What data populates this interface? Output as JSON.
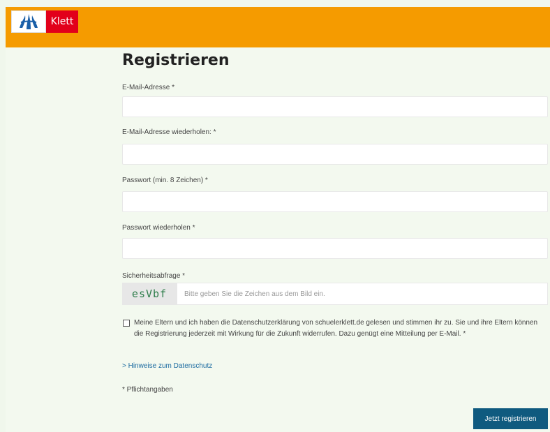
{
  "header": {
    "brand": "Klett",
    "bg_color": "#f59b00",
    "brand_color": "#e2001a"
  },
  "form": {
    "title": "Registrieren",
    "email_label": "E-Mail-Adresse *",
    "email_value": "",
    "email_repeat_label": "E-Mail-Adresse wiederholen: *",
    "email_repeat_value": "",
    "password_label": "Passwort (min. 8 Zeichen) *",
    "password_value": "",
    "password_repeat_label": "Passwort wiederholen *",
    "password_repeat_value": "",
    "captcha_label": "Sicherheitsabfrage *",
    "captcha_image_text": "esVbf",
    "captcha_placeholder": "Bitte geben Sie die Zeichen aus dem Bild ein.",
    "consent_checked": false,
    "consent_text": "Meine Eltern und ich haben die Datenschutzerklärung von schuelerklett.de gelesen und stimmen ihr zu. Sie und ihre Eltern können die Registrierung jederzeit mit Wirkung für die Zukunft widerrufen. Dazu genügt eine Mitteilung per E-Mail. *",
    "privacy_link": "> Hinweise zum Datenschutz",
    "required_note": "* Pflichtangaben",
    "submit_label": "Jetzt registrieren",
    "submit_color": "#0f5a7f"
  }
}
